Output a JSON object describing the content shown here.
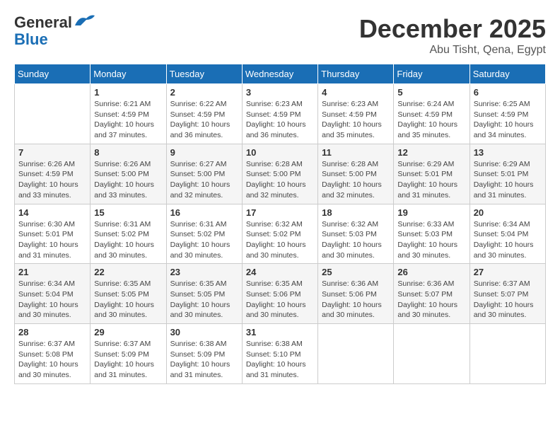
{
  "logo": {
    "line1": "General",
    "line2": "Blue"
  },
  "header": {
    "month_title": "December 2025",
    "subtitle": "Abu Tisht, Qena, Egypt"
  },
  "weekdays": [
    "Sunday",
    "Monday",
    "Tuesday",
    "Wednesday",
    "Thursday",
    "Friday",
    "Saturday"
  ],
  "weeks": [
    [
      {
        "day": "",
        "info": ""
      },
      {
        "day": "1",
        "info": "Sunrise: 6:21 AM\nSunset: 4:59 PM\nDaylight: 10 hours\nand 37 minutes."
      },
      {
        "day": "2",
        "info": "Sunrise: 6:22 AM\nSunset: 4:59 PM\nDaylight: 10 hours\nand 36 minutes."
      },
      {
        "day": "3",
        "info": "Sunrise: 6:23 AM\nSunset: 4:59 PM\nDaylight: 10 hours\nand 36 minutes."
      },
      {
        "day": "4",
        "info": "Sunrise: 6:23 AM\nSunset: 4:59 PM\nDaylight: 10 hours\nand 35 minutes."
      },
      {
        "day": "5",
        "info": "Sunrise: 6:24 AM\nSunset: 4:59 PM\nDaylight: 10 hours\nand 35 minutes."
      },
      {
        "day": "6",
        "info": "Sunrise: 6:25 AM\nSunset: 4:59 PM\nDaylight: 10 hours\nand 34 minutes."
      }
    ],
    [
      {
        "day": "7",
        "info": "Sunrise: 6:26 AM\nSunset: 4:59 PM\nDaylight: 10 hours\nand 33 minutes."
      },
      {
        "day": "8",
        "info": "Sunrise: 6:26 AM\nSunset: 5:00 PM\nDaylight: 10 hours\nand 33 minutes."
      },
      {
        "day": "9",
        "info": "Sunrise: 6:27 AM\nSunset: 5:00 PM\nDaylight: 10 hours\nand 32 minutes."
      },
      {
        "day": "10",
        "info": "Sunrise: 6:28 AM\nSunset: 5:00 PM\nDaylight: 10 hours\nand 32 minutes."
      },
      {
        "day": "11",
        "info": "Sunrise: 6:28 AM\nSunset: 5:00 PM\nDaylight: 10 hours\nand 32 minutes."
      },
      {
        "day": "12",
        "info": "Sunrise: 6:29 AM\nSunset: 5:01 PM\nDaylight: 10 hours\nand 31 minutes."
      },
      {
        "day": "13",
        "info": "Sunrise: 6:29 AM\nSunset: 5:01 PM\nDaylight: 10 hours\nand 31 minutes."
      }
    ],
    [
      {
        "day": "14",
        "info": "Sunrise: 6:30 AM\nSunset: 5:01 PM\nDaylight: 10 hours\nand 31 minutes."
      },
      {
        "day": "15",
        "info": "Sunrise: 6:31 AM\nSunset: 5:02 PM\nDaylight: 10 hours\nand 30 minutes."
      },
      {
        "day": "16",
        "info": "Sunrise: 6:31 AM\nSunset: 5:02 PM\nDaylight: 10 hours\nand 30 minutes."
      },
      {
        "day": "17",
        "info": "Sunrise: 6:32 AM\nSunset: 5:02 PM\nDaylight: 10 hours\nand 30 minutes."
      },
      {
        "day": "18",
        "info": "Sunrise: 6:32 AM\nSunset: 5:03 PM\nDaylight: 10 hours\nand 30 minutes."
      },
      {
        "day": "19",
        "info": "Sunrise: 6:33 AM\nSunset: 5:03 PM\nDaylight: 10 hours\nand 30 minutes."
      },
      {
        "day": "20",
        "info": "Sunrise: 6:34 AM\nSunset: 5:04 PM\nDaylight: 10 hours\nand 30 minutes."
      }
    ],
    [
      {
        "day": "21",
        "info": "Sunrise: 6:34 AM\nSunset: 5:04 PM\nDaylight: 10 hours\nand 30 minutes."
      },
      {
        "day": "22",
        "info": "Sunrise: 6:35 AM\nSunset: 5:05 PM\nDaylight: 10 hours\nand 30 minutes."
      },
      {
        "day": "23",
        "info": "Sunrise: 6:35 AM\nSunset: 5:05 PM\nDaylight: 10 hours\nand 30 minutes."
      },
      {
        "day": "24",
        "info": "Sunrise: 6:35 AM\nSunset: 5:06 PM\nDaylight: 10 hours\nand 30 minutes."
      },
      {
        "day": "25",
        "info": "Sunrise: 6:36 AM\nSunset: 5:06 PM\nDaylight: 10 hours\nand 30 minutes."
      },
      {
        "day": "26",
        "info": "Sunrise: 6:36 AM\nSunset: 5:07 PM\nDaylight: 10 hours\nand 30 minutes."
      },
      {
        "day": "27",
        "info": "Sunrise: 6:37 AM\nSunset: 5:07 PM\nDaylight: 10 hours\nand 30 minutes."
      }
    ],
    [
      {
        "day": "28",
        "info": "Sunrise: 6:37 AM\nSunset: 5:08 PM\nDaylight: 10 hours\nand 30 minutes."
      },
      {
        "day": "29",
        "info": "Sunrise: 6:37 AM\nSunset: 5:09 PM\nDaylight: 10 hours\nand 31 minutes."
      },
      {
        "day": "30",
        "info": "Sunrise: 6:38 AM\nSunset: 5:09 PM\nDaylight: 10 hours\nand 31 minutes."
      },
      {
        "day": "31",
        "info": "Sunrise: 6:38 AM\nSunset: 5:10 PM\nDaylight: 10 hours\nand 31 minutes."
      },
      {
        "day": "",
        "info": ""
      },
      {
        "day": "",
        "info": ""
      },
      {
        "day": "",
        "info": ""
      }
    ]
  ]
}
